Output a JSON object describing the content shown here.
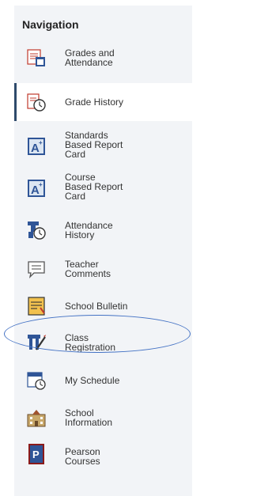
{
  "nav": {
    "title": "Navigation",
    "items": [
      {
        "label": "Grades and\nAttendance",
        "icon": "grades-attendance-icon"
      },
      {
        "label": "Grade History",
        "icon": "grade-history-icon",
        "active": true
      },
      {
        "label": "Standards\nBased Report\nCard",
        "icon": "standards-report-card-icon"
      },
      {
        "label": "Course\nBased Report\nCard",
        "icon": "course-report-card-icon"
      },
      {
        "label": "Attendance\nHistory",
        "icon": "attendance-history-icon"
      },
      {
        "label": "Teacher\nComments",
        "icon": "teacher-comments-icon"
      },
      {
        "label": "School Bulletin",
        "icon": "school-bulletin-icon"
      },
      {
        "label": "Class\nRegistration",
        "icon": "class-registration-icon",
        "highlighted": true
      },
      {
        "label": "My Schedule",
        "icon": "my-schedule-icon"
      },
      {
        "label": "School\nInformation",
        "icon": "school-information-icon"
      },
      {
        "label": "Pearson\nCourses",
        "icon": "pearson-courses-icon"
      }
    ]
  },
  "colors": {
    "accent": "#2e4a6b",
    "highlight": "#4472c4",
    "nav_bg": "#f2f4f7"
  }
}
